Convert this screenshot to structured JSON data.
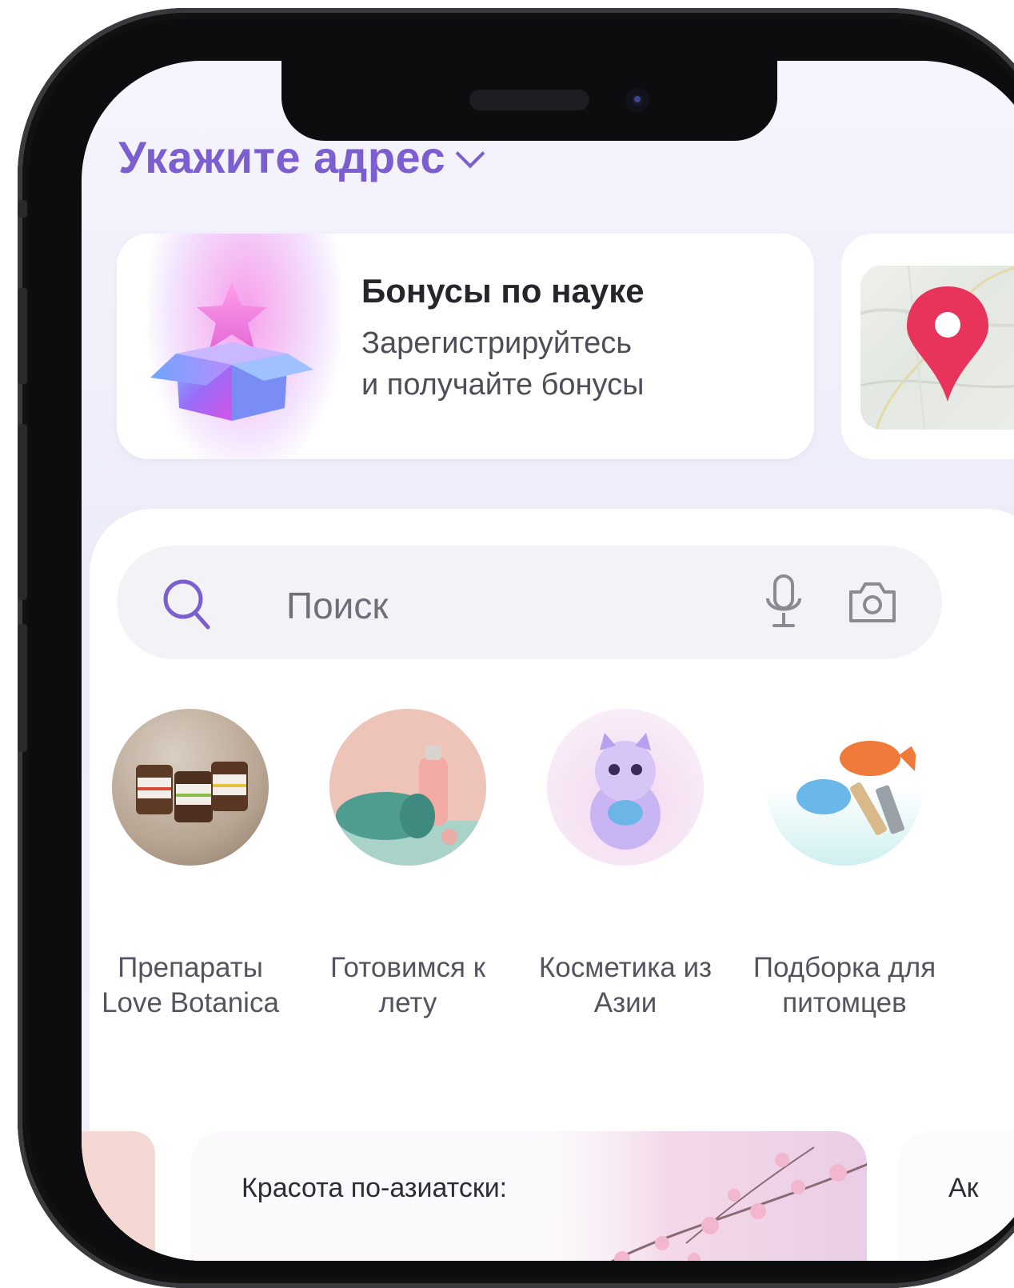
{
  "header": {
    "address_label": "Укажите адрес"
  },
  "promo": {
    "title": "Бонусы по науке",
    "line1": "Зарегистрируйтесь",
    "line2": "и получайте бонусы"
  },
  "search": {
    "placeholder": "Поиск"
  },
  "categories": [
    {
      "line1": "Препараты",
      "line2": "Love Botanica"
    },
    {
      "line1": "Готовимся к",
      "line2": "лету"
    },
    {
      "line1": "Косметика из",
      "line2": "Азии"
    },
    {
      "line1": "Подборка для",
      "line2": "питомцев"
    }
  ],
  "cards": {
    "beauty_title": "Красота по-азиатски:",
    "right_card_text": "Ак"
  },
  "icons": [
    "search-icon",
    "microphone-icon",
    "camera-icon",
    "chevron-down-icon",
    "map-pin-icon",
    "gift-box-icon"
  ],
  "colors": {
    "accent": "#7b5fd0",
    "pin": "#e8335a"
  }
}
